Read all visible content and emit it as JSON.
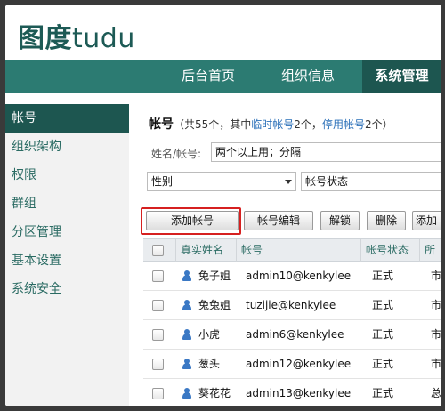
{
  "logo": {
    "cn": "图度",
    "en": "tudu"
  },
  "topnav": [
    {
      "label": "后台首页"
    },
    {
      "label": "组织信息"
    },
    {
      "label": "系统管理",
      "active": true
    }
  ],
  "sidebar": {
    "items": [
      {
        "label": "帐号",
        "active": true
      },
      {
        "label": "组织架构"
      },
      {
        "label": "权限"
      },
      {
        "label": "群组"
      },
      {
        "label": "分区管理"
      },
      {
        "label": "基本设置"
      },
      {
        "label": "系统安全"
      }
    ]
  },
  "summary": {
    "title": "帐号",
    "part1": "（共55个，其中",
    "temp_link": "临时帐号",
    "part2": "2个，",
    "disabled_link": "停用帐号",
    "part3": "2个）"
  },
  "filters": {
    "name_label": "姓名/帐号:",
    "name_value": "两个以上用；分隔",
    "gender_select": "性别",
    "status_select": "帐号状态"
  },
  "toolbar": {
    "add": "添加帐号",
    "edit": "帐号编辑",
    "unlock": "解锁",
    "delete": "删除",
    "more": "添加"
  },
  "table": {
    "headers": [
      "真实姓名",
      "帐号",
      "帐号状态",
      "所"
    ],
    "rows": [
      {
        "name": "兔子姐",
        "account": "admin10@kenkylee",
        "status": "正式",
        "dept": "市"
      },
      {
        "name": "兔兔姐",
        "account": "tuzijie@kenkylee",
        "status": "正式",
        "dept": "市"
      },
      {
        "name": "小虎",
        "account": "admin6@kenkylee",
        "status": "正式",
        "dept": "市"
      },
      {
        "name": "葱头",
        "account": "admin12@kenkylee",
        "status": "正式",
        "dept": "市"
      },
      {
        "name": "葵花花",
        "account": "admin13@kenkylee",
        "status": "正式",
        "dept": "总"
      }
    ]
  },
  "colors": {
    "nav_bg": "#2c7b72",
    "nav_active": "#1d5650",
    "accent_text": "#2a6b63",
    "link": "#2a6fb8",
    "highlight": "#d62020"
  }
}
